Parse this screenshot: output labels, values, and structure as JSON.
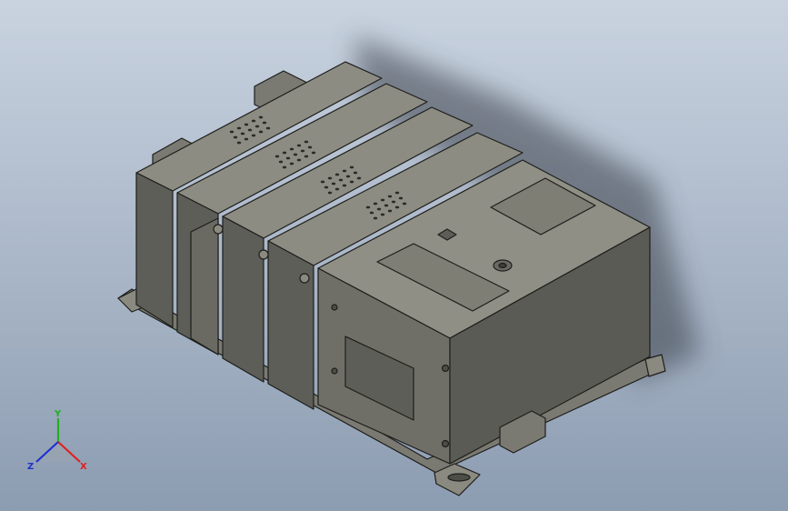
{
  "viewport": {
    "background_top": "#c9d3e0",
    "background_bottom": "#8c9cb1"
  },
  "model": {
    "body_color": "#6f6f67",
    "body_light": "#8c8c82",
    "body_dark": "#4d4d47",
    "edge_color": "#1e1e1c",
    "shadow_color": "#3a3f48",
    "module_count": 4
  },
  "triad": {
    "x_label": "X",
    "y_label": "Y",
    "z_label": "Z",
    "x_color": "#e02020",
    "y_color": "#20b020",
    "z_color": "#2030d0"
  }
}
